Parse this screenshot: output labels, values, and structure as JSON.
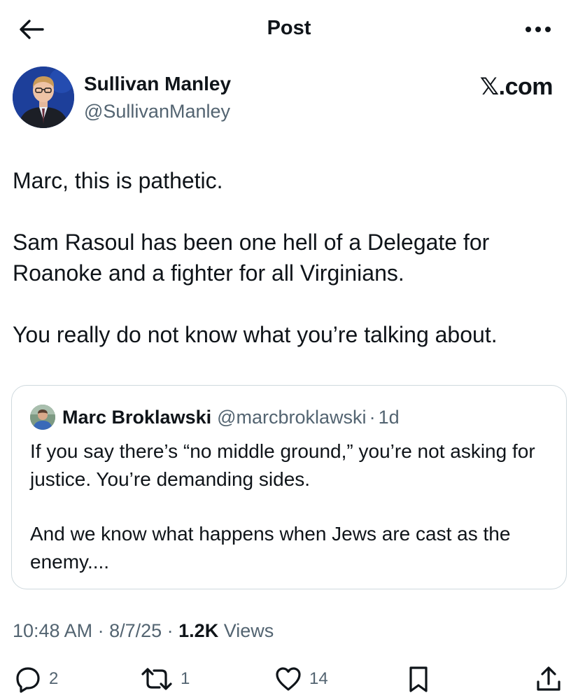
{
  "header": {
    "title": "Post"
  },
  "author": {
    "name": "Sullivan Manley",
    "handle": "@SullivanManley",
    "brand": "𝕏.com"
  },
  "post": {
    "paragraphs": [
      "Marc, this is pathetic.",
      "Sam Rasoul has been one hell of a Delegate for Roanoke and a fighter for all Virginians.",
      "You really do not know what you’re talking about."
    ]
  },
  "quote": {
    "name": "Marc Broklawski",
    "handle": "@marcbroklawski",
    "separator": "·",
    "time": "1d",
    "paragraphs": [
      "If you say there’s “no middle ground,” you’re not asking for justice. You’re demanding sides.",
      "And we know what happens when Jews are cast as the enemy...."
    ]
  },
  "meta": {
    "time": "10:48 AM",
    "sep1": " · ",
    "date": "8/7/25",
    "sep2": " · ",
    "views_count": "1.2K",
    "views_label": " Views"
  },
  "actions": {
    "replies": "2",
    "reposts": "1",
    "likes": "14"
  },
  "icons": {
    "back": "arrow-left-icon",
    "more": "more-icon",
    "reply": "reply-icon",
    "repost": "repost-icon",
    "like": "heart-icon",
    "bookmark": "bookmark-icon",
    "share": "share-icon"
  },
  "colors": {
    "text": "#0f1419",
    "secondary": "#536471",
    "border": "#cfd9de"
  }
}
